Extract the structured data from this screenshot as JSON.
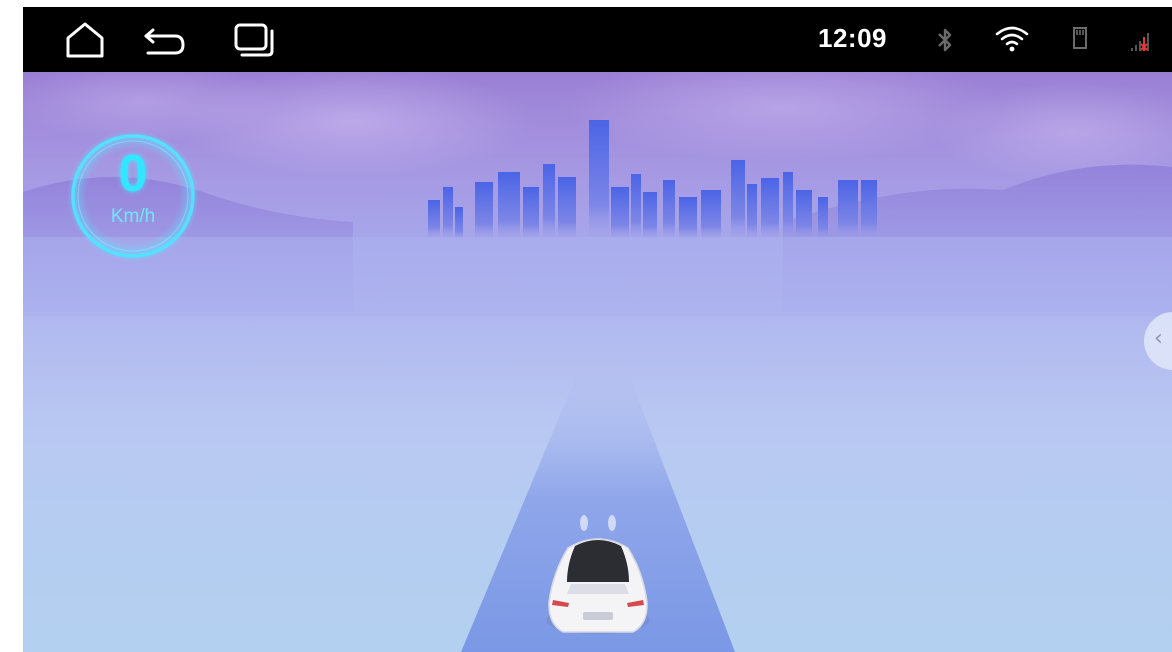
{
  "status_bar": {
    "nav_buttons": [
      {
        "name": "home-button",
        "icon": "home-icon"
      },
      {
        "name": "back-button",
        "icon": "back-arrow-icon"
      },
      {
        "name": "recent-apps-button",
        "icon": "recent-apps-icon"
      }
    ],
    "time": "12:09",
    "icons": [
      "bluetooth-icon",
      "wifi-icon",
      "sd-card-icon",
      "signal-icon"
    ],
    "signal_alert_color": "#e53935"
  },
  "speedometer": {
    "value": "0",
    "unit": "Km/h",
    "color": "#33e6ff"
  },
  "side_panel": {
    "handle_icon": "chevron-left-icon",
    "glyph": "‹"
  },
  "scene": {
    "background_top": "#a58ad8",
    "background_bottom": "#b3d0f0",
    "road_color": "#7f9ce8",
    "car_color": "#f4f4f6"
  }
}
